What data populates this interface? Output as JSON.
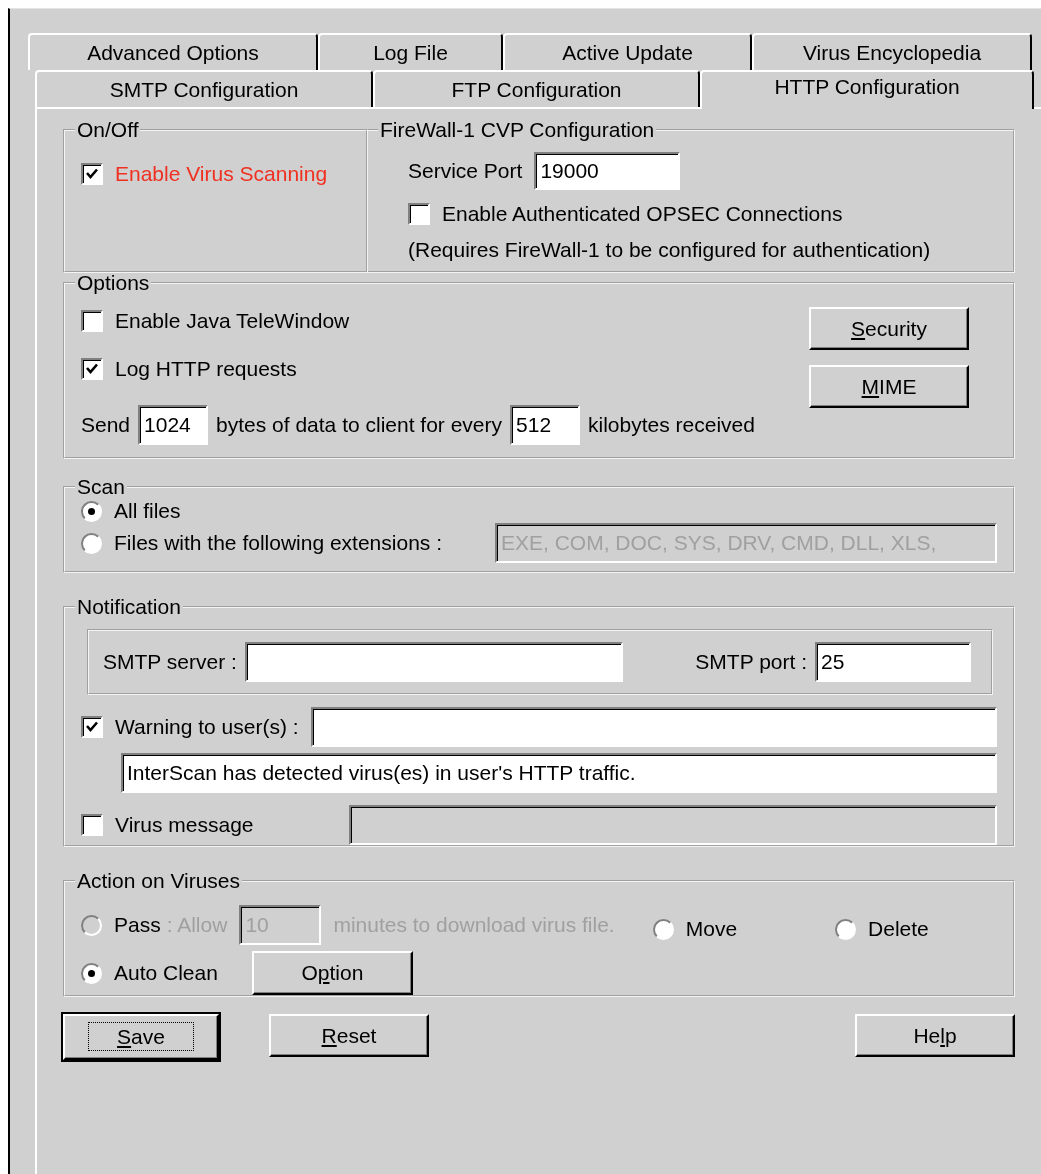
{
  "tab_rows": [
    [
      {
        "label": "Advanced Options",
        "selected": false
      },
      {
        "label": "Log File",
        "selected": false
      },
      {
        "label": "Active Update",
        "selected": false
      },
      {
        "label": "Virus Encyclopedia",
        "selected": false
      }
    ],
    [
      {
        "label": "SMTP Configuration",
        "selected": false
      },
      {
        "label": "FTP Configuration",
        "selected": false
      },
      {
        "label": "HTTP Configuration",
        "selected": true
      }
    ]
  ],
  "on_off": {
    "title": "On/Off",
    "checkbox": {
      "label": "Enable Virus Scanning",
      "checked": true
    }
  },
  "firewall": {
    "title": "FireWall-1 CVP Configuration",
    "service_port": {
      "label": "Service Port",
      "value": "19000"
    },
    "opsec": {
      "label": "Enable Authenticated OPSEC Connections",
      "checked": false
    },
    "note": "(Requires FireWall-1 to be configured for authentication)"
  },
  "options": {
    "title": "Options",
    "checkboxes": [
      {
        "label": "Enable Java TeleWindow",
        "checked": false
      },
      {
        "label": "Log HTTP requests",
        "checked": true
      }
    ],
    "send": {
      "lead": "Send",
      "bytes": "1024",
      "middle": "bytes of data to client for every",
      "kilobytes": "512",
      "tail": "kilobytes received"
    },
    "buttons": [
      {
        "key": "S",
        "after": "ecurity"
      },
      {
        "key": "M",
        "after": "IME"
      }
    ]
  },
  "scan": {
    "title": "Scan",
    "radios": [
      {
        "label": "All files",
        "selected": true
      },
      {
        "label": "Files with the following extensions :",
        "selected": false
      }
    ],
    "extensions": {
      "value": "EXE, COM, DOC, SYS, DRV, CMD, DLL, XLS,",
      "disabled": true
    }
  },
  "notification": {
    "title": "Notification",
    "smtp_server": {
      "label": "SMTP server :"
    },
    "smtp_port": {
      "label": "SMTP port :",
      "value": "25"
    },
    "warning": {
      "label": "Warning to user(s) :",
      "checked": true,
      "message": "InterScan has detected virus(es) in user's HTTP traffic."
    },
    "virus_message": {
      "label": "Virus message",
      "checked": false,
      "disabled": true
    }
  },
  "action": {
    "title": "Action on Viruses",
    "pass": {
      "label": "Pass",
      "allow": ": Allow",
      "minutes": "10",
      "after": "minutes to download virus file.",
      "selected": false,
      "disabled": true
    },
    "move": {
      "label": "Move",
      "selected": false
    },
    "delete": {
      "label": "Delete",
      "selected": false
    },
    "auto_clean": {
      "label": "Auto Clean",
      "selected": true
    },
    "option_button": {
      "before": "O",
      "key": "p",
      "after": "tion"
    }
  },
  "buttons": [
    {
      "key": "S",
      "after": "ave",
      "default": true
    },
    {
      "key": "R",
      "after": "eset",
      "default": false
    },
    {
      "before": "He",
      "key": "l",
      "after": "p",
      "default": false
    }
  ]
}
